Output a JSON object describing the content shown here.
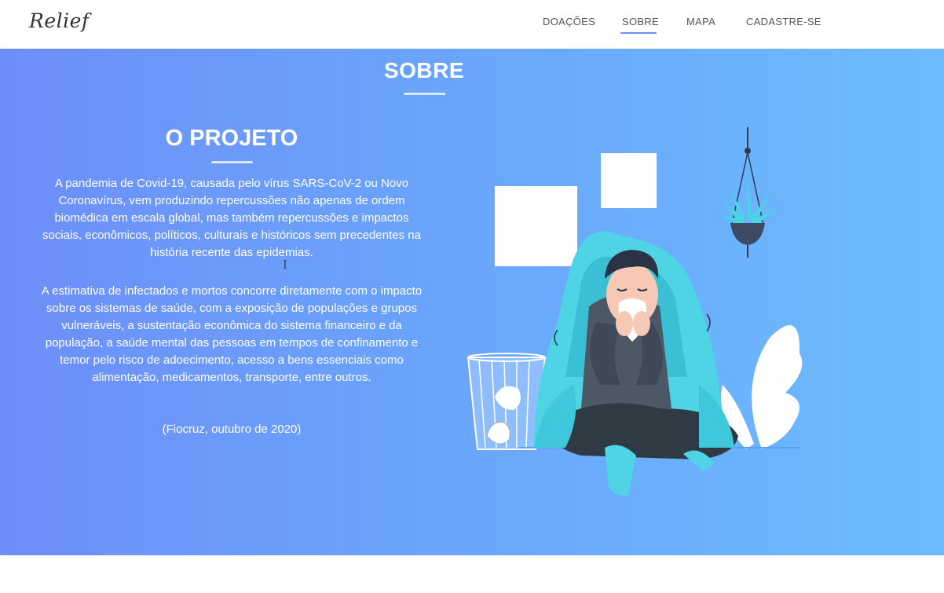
{
  "brand": {
    "logo_text": "Relief"
  },
  "nav": {
    "items": [
      {
        "label": "DOAÇÕES",
        "active": false
      },
      {
        "label": "SOBRE",
        "active": true
      },
      {
        "label": "MAPA",
        "active": false
      },
      {
        "label": "CADASTRE-SE",
        "active": false
      }
    ]
  },
  "section": {
    "title": "SOBRE",
    "project_title": "O PROJETO",
    "paragraph_1": "A pandemia de Covid-19, causada pelo vírus SARS-CoV-2 ou Novo Coronavírus, vem produzindo repercussões não apenas de ordem biomédica em escala global, mas também repercussões e impactos sociais, econômicos, políticos, culturais e históricos sem precedentes na história recente das epidemias.",
    "paragraph_2": "A estimativa de infectados e mortos concorre diretamente com o impacto sobre os sistemas de saúde, com a exposição de populações e grupos vulneráveis, a sustentação econômica do sistema financeiro e da população, a saúde mental das pessoas em tempos de confinamento e temor pelo risco de adoecimento, acesso a bens essenciais como alimentação, medicamentos, transporte, entre outros.",
    "citation": "(Fiocruz, outubro de 2020)"
  },
  "colors": {
    "gradient_start": "#6d8ef9",
    "gradient_end": "#6cbcfd",
    "nav_active": "#6b8cf6",
    "blanket": "#4fd4e6"
  },
  "illustration": {
    "icon": "sick-person-illustration"
  }
}
